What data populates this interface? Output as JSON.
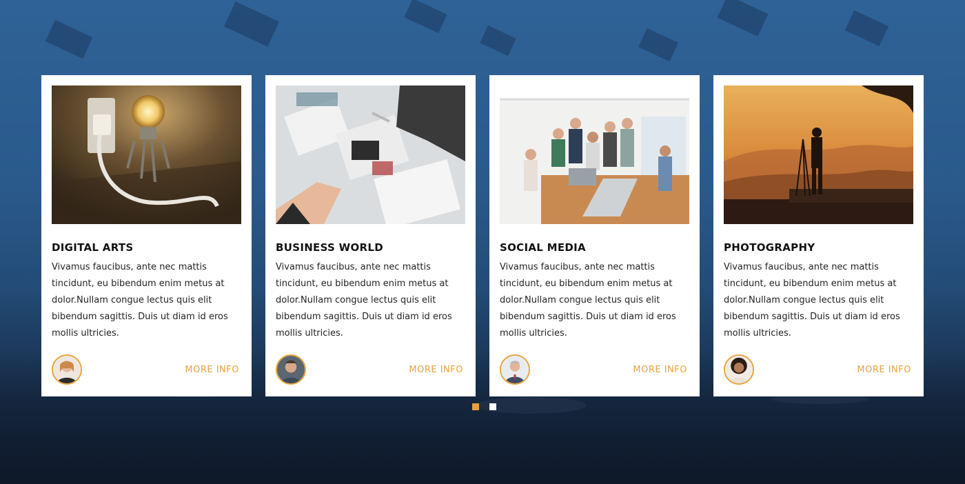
{
  "cards": [
    {
      "title": "DIGITAL ARTS",
      "description": "Vivamus faucibus, ante nec mattis tincidunt, eu bibendum enim metus at dolor.Nullam congue lectus quis elit bibendum sagittis. Duis ut diam id eros mollis ultricies.",
      "more_label": "MORE INFO",
      "image": "lightbulb-plugging-socket-photo",
      "avatar": "woman-portrait-avatar"
    },
    {
      "title": "BUSINESS WORLD",
      "description": "Vivamus faucibus, ante nec mattis tincidunt, eu bibendum enim metus at dolor.Nullam congue lectus quis elit bibendum sagittis. Duis ut diam id eros mollis ultricies.",
      "more_label": "MORE INFO",
      "image": "desk-papers-hands-photo",
      "avatar": "man-portrait-avatar"
    },
    {
      "title": "SOCIAL MEDIA",
      "description": "Vivamus faucibus, ante nec mattis tincidunt, eu bibendum enim metus at dolor.Nullam congue lectus quis elit bibendum sagittis. Duis ut diam id eros mollis ultricies.",
      "more_label": "MORE INFO",
      "image": "team-around-laptops-photo",
      "avatar": "older-man-portrait-avatar"
    },
    {
      "title": "PHOTOGRAPHY",
      "description": "Vivamus faucibus, ante nec mattis tincidunt, eu bibendum enim metus at dolor.Nullam congue lectus quis elit bibendum sagittis. Duis ut diam id eros mollis ultricies.",
      "more_label": "MORE INFO",
      "image": "photographer-sunset-photo",
      "avatar": "smiling-woman-portrait-avatar"
    }
  ],
  "pagination": {
    "total": 2,
    "active": 1
  },
  "colors": {
    "accent": "#e9a23b",
    "background_top": "#2f6296",
    "background_bottom": "#121f34",
    "card": "#ffffff",
    "dot_inactive": "#ffffff"
  }
}
